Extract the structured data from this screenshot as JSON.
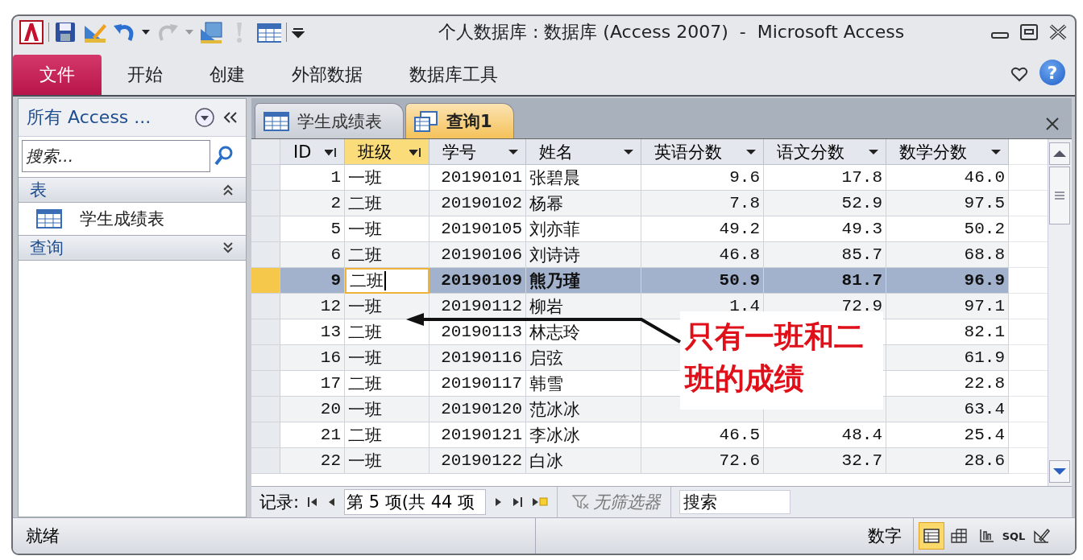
{
  "window": {
    "title": "个人数据库 : 数据库 (Access 2007)  -  Microsoft Access"
  },
  "quick_access": [
    {
      "kind": "save",
      "disabled": false
    },
    {
      "kind": "design",
      "disabled": false
    },
    {
      "kind": "undo",
      "disabled": false
    },
    {
      "kind": "redo",
      "disabled": true
    },
    {
      "kind": "view",
      "disabled": false
    },
    {
      "kind": "run",
      "disabled": true
    },
    {
      "kind": "datasheet",
      "disabled": false
    }
  ],
  "ribbon_tabs": [
    {
      "label": "文件",
      "selected": true
    },
    {
      "label": "开始",
      "selected": false
    },
    {
      "label": "创建",
      "selected": false
    },
    {
      "label": "外部数据",
      "selected": false
    },
    {
      "label": "数据库工具",
      "selected": false
    }
  ],
  "help": "?",
  "nav_pane": {
    "title": "所有 Access ...",
    "search": {
      "placeholder": "搜索..."
    },
    "groups": [
      {
        "label": "表",
        "expanded": true,
        "items": [
          {
            "label": "学生成绩表"
          }
        ]
      },
      {
        "label": "查询",
        "expanded": false
      }
    ]
  },
  "doc_tabs": [
    {
      "label": "学生成绩表",
      "kind": "table",
      "selected": false
    },
    {
      "label": "查询1",
      "kind": "query",
      "selected": true
    }
  ],
  "datasheet": {
    "columns": [
      {
        "label": "ID",
        "kind": "number",
        "filtered": true,
        "selected": false
      },
      {
        "label": "班级",
        "kind": "text",
        "filtered": true,
        "selected": true
      },
      {
        "label": "学号",
        "kind": "number",
        "filtered": false,
        "selected": false
      },
      {
        "label": "姓名",
        "kind": "text",
        "filtered": false,
        "selected": false
      },
      {
        "label": "英语分数",
        "kind": "number",
        "filtered": false,
        "selected": false
      },
      {
        "label": "语文分数",
        "kind": "number",
        "filtered": false,
        "selected": false
      },
      {
        "label": "数学分数",
        "kind": "number",
        "filtered": false,
        "selected": false
      }
    ],
    "rows": [
      {
        "selected": false,
        "cells": [
          "1",
          "一班",
          "20190101",
          "张碧晨",
          "9.6",
          "17.8",
          "46.0"
        ]
      },
      {
        "selected": false,
        "cells": [
          "2",
          "二班",
          "20190102",
          "杨幂",
          "7.8",
          "52.9",
          "97.5"
        ]
      },
      {
        "selected": false,
        "cells": [
          "5",
          "一班",
          "20190105",
          "刘亦菲",
          "49.2",
          "49.3",
          "50.2"
        ]
      },
      {
        "selected": false,
        "cells": [
          "6",
          "二班",
          "20190106",
          "刘诗诗",
          "46.8",
          "85.7",
          "68.8"
        ]
      },
      {
        "selected": true,
        "cells": [
          "9",
          "二班",
          "20190109",
          "熊乃瑾",
          "50.9",
          "81.7",
          "96.9"
        ]
      },
      {
        "selected": false,
        "cells": [
          "12",
          "一班",
          "20190112",
          "柳岩",
          "1.4",
          "72.9",
          "97.1"
        ]
      },
      {
        "selected": false,
        "cells": [
          "13",
          "二班",
          "20190113",
          "林志玲",
          null,
          null,
          "82.1"
        ]
      },
      {
        "selected": false,
        "cells": [
          "16",
          "一班",
          "20190116",
          "启弦",
          null,
          null,
          "61.9"
        ]
      },
      {
        "selected": false,
        "cells": [
          "17",
          "二班",
          "20190117",
          "韩雪",
          null,
          null,
          "22.8"
        ]
      },
      {
        "selected": false,
        "cells": [
          "20",
          "一班",
          "20190120",
          "范冰冰",
          null,
          null,
          "63.4"
        ]
      },
      {
        "selected": false,
        "cells": [
          "21",
          "二班",
          "20190121",
          "李冰冰",
          "46.5",
          "48.4",
          "25.4"
        ]
      },
      {
        "selected": false,
        "cells": [
          "22",
          "一班",
          "20190122",
          "白冰",
          "72.6",
          "32.7",
          "28.6"
        ]
      }
    ]
  },
  "record_nav": {
    "label": "记录:",
    "position": "第 5 项(共 44 项",
    "filter": "无筛选器",
    "search": {
      "placeholder": "搜索"
    }
  },
  "callout": {
    "text": "只有一班和二班的成绩"
  },
  "status_bar": {
    "text": "就绪",
    "mode": "数字",
    "views": [
      {
        "kind": "datasheet",
        "selected": true
      },
      {
        "kind": "pivot_table",
        "selected": false
      },
      {
        "kind": "pivot_chart",
        "selected": false
      },
      {
        "kind": "sql",
        "label": "SQL",
        "selected": false
      },
      {
        "kind": "design",
        "selected": false
      }
    ]
  }
}
